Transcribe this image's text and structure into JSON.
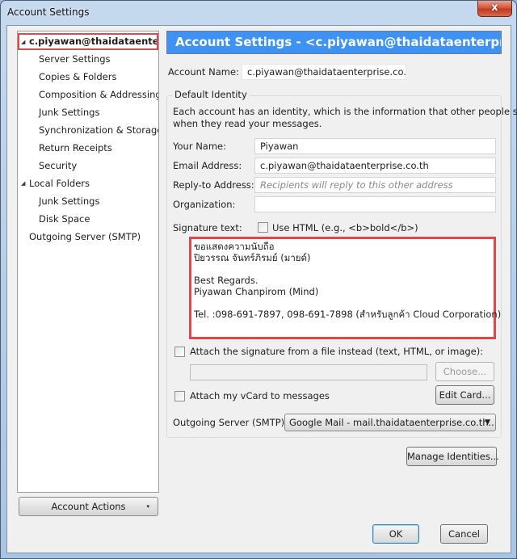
{
  "window": {
    "title": "Account Settings",
    "close_glyph": "x"
  },
  "sidebar": {
    "items": [
      {
        "label": "c.piyawan@thaidataenterp...",
        "level": 0,
        "expanded": true,
        "selected": true
      },
      {
        "label": "Server Settings",
        "level": 1
      },
      {
        "label": "Copies & Folders",
        "level": 1
      },
      {
        "label": "Composition & Addressing",
        "level": 1
      },
      {
        "label": "Junk Settings",
        "level": 1
      },
      {
        "label": "Synchronization & Storage",
        "level": 1
      },
      {
        "label": "Return Receipts",
        "level": 1
      },
      {
        "label": "Security",
        "level": 1
      },
      {
        "label": "Local Folders",
        "level": 0,
        "expanded": true
      },
      {
        "label": "Junk Settings",
        "level": 1
      },
      {
        "label": "Disk Space",
        "level": 1
      },
      {
        "label": "Outgoing Server (SMTP)",
        "level": 0
      }
    ],
    "account_actions_label": "Account Actions",
    "twisty_glyph": "◢",
    "dropdown_glyph": "▾"
  },
  "main": {
    "header": "Account Settings - <c.piyawan@thaidataenterprise.c...",
    "account_name_label": "Account Name:",
    "account_name_value": "c.piyawan@thaidataenterprise.co.th",
    "identity": {
      "legend": "Default Identity",
      "description_line1": "Each account has an identity, which is the information that other people see",
      "description_line2": "when they read your messages.",
      "your_name_label": "Your Name:",
      "your_name_value": "Piyawan",
      "email_label": "Email Address:",
      "email_value": "c.piyawan@thaidataenterprise.co.th",
      "reply_to_label": "Reply-to Address:",
      "reply_to_placeholder": "Recipients will reply to this other address",
      "organization_label": "Organization:",
      "organization_value": "",
      "signature_label": "Signature text:",
      "use_html_label": "Use HTML (e.g., <b>bold</b>)",
      "use_html_checked": false,
      "signature_text": "ขอแสดงความนับถือ\nปิยวรรณ จันทร์ภิรมย์ (มายด์)\n\nBest Regards.\nPiyawan Chanpirom (Mind)\n\nTel. :098-691-7897, 098-691-7898 (สำหรับลูกค้า Cloud Corporation)",
      "attach_file_label": "Attach the signature from a file instead (text, HTML, or image):",
      "attach_file_checked": false,
      "attach_file_path": "",
      "choose_label": "Choose...",
      "attach_vcard_label": "Attach my vCard to messages",
      "attach_vcard_checked": false,
      "edit_card_label": "Edit Card...",
      "outgoing_server_label": "Outgoing Server (SMTP):",
      "outgoing_server_value": "Google Mail - mail.thaidataenterprise.co.th...",
      "select_arrow_glyph": "▼"
    },
    "manage_identities_label": "Manage Identities..."
  },
  "footer": {
    "ok_label": "OK",
    "cancel_label": "Cancel"
  },
  "colors": {
    "header_blue": "#3d92f3",
    "highlight_red": "#e0474a"
  }
}
